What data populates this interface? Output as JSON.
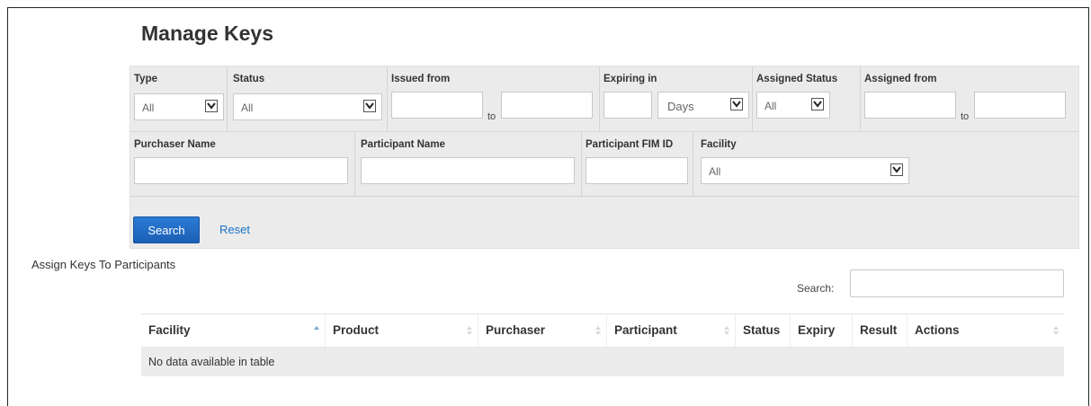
{
  "page": {
    "title": "Manage Keys"
  },
  "filters": {
    "type": {
      "label": "Type",
      "value": "All"
    },
    "status": {
      "label": "Status",
      "value": "All"
    },
    "issued_from": {
      "label": "Issued from",
      "to_label": "to"
    },
    "expiring_in": {
      "label": "Expiring in",
      "unit_value": "Days"
    },
    "assigned_status": {
      "label": "Assigned Status",
      "value": "All"
    },
    "assigned_from": {
      "label": "Assigned from",
      "to_label": "to"
    },
    "purchaser_name": {
      "label": "Purchaser Name"
    },
    "participant_name": {
      "label": "Participant Name"
    },
    "participant_fim_id": {
      "label": "Participant FIM ID"
    },
    "facility": {
      "label": "Facility",
      "value": "All"
    }
  },
  "actions": {
    "search_label": "Search",
    "reset_label": "Reset"
  },
  "assign_link": "Assign Keys To Participants",
  "table_search": {
    "label": "Search:"
  },
  "table": {
    "columns": [
      "Facility",
      "Product",
      "Purchaser",
      "Participant",
      "Status",
      "Expiry",
      "Result",
      "Actions"
    ],
    "empty_message": "No data available in table",
    "sorted_column": "Facility"
  },
  "colors": {
    "accent": "#1a66c2",
    "link": "#1b73c7",
    "panel_bg": "#ebebeb"
  }
}
